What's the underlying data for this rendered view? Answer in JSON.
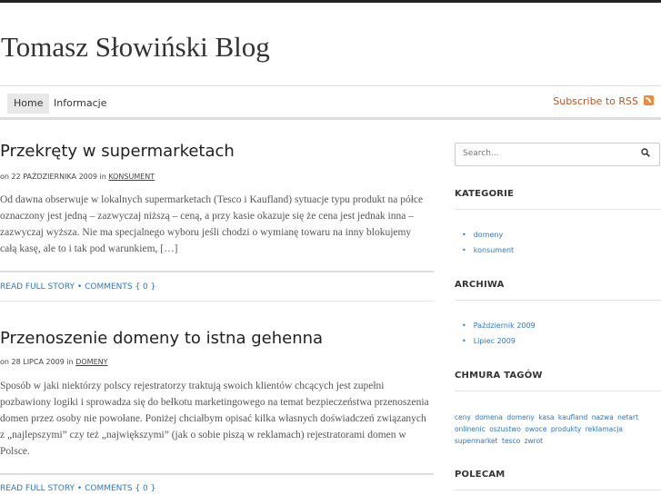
{
  "site": {
    "title": "Tomasz Słowiński Blog"
  },
  "nav": {
    "items": [
      {
        "label": "Home",
        "active": true
      },
      {
        "label": "Informacje",
        "active": false
      }
    ],
    "rss_label": "Subscribe to RSS"
  },
  "posts": [
    {
      "title": "Przekręty w supermarketach",
      "meta_prefix": "on 22 PAŹDZIERNIKA 2009 in",
      "category": "KONSUMENT",
      "body": "Od dawna obserwuje w lokalnych supermarketach (Tesco i Kaufland) sytuacje typu produkt na półce oznaczony jest jedną – zazwyczaj niższą – ceną, a przy kasie okazuje się że cena jest jednak inna – zazwyczaj wyższa. Nie ma specjalnego wyboru jeśli chodzi o wymianę towaru na inny blokujemy całą kasę, ale to i tak pod warunkiem, […]",
      "read_more": "READ FULL STORY",
      "comments": "COMMENTS { 0 }"
    },
    {
      "title": "Przenoszenie domeny to istna gehenna",
      "meta_prefix": "on 28 LIPCA 2009 in",
      "category": "DOMENY",
      "body": "Sposób w jaki niektórzy polscy rejestratorzy traktują swoich klientów chcących jest zupełni pozbawiony logiki i sprowadza się do bełkotu marketingowego na temat bezpieczeństwa przenoszenia domen przez osoby nie powołane. Poniżej chciałbym opisać kilka własnych doświadczeń związanych z „najlepszymi” czy też „największymi” (jak o sobie piszą w reklamach) rejestratorami domen w Polsce.",
      "read_more": "READ FULL STORY",
      "comments": "COMMENTS { 0 }"
    }
  ],
  "sidebar": {
    "search_placeholder": "Search...",
    "categories_title": "KATEGORIE",
    "categories": [
      "domeny",
      "konsument"
    ],
    "archives_title": "ARCHIWA",
    "archives": [
      "Październik 2009",
      "Lipiec 2009"
    ],
    "tags_title": "CHMURA TAGÓW",
    "tags": [
      "ceny",
      "domena",
      "domeny",
      "kasa",
      "kaufland",
      "nazwa",
      "netart",
      "onlinenic",
      "oszustwo",
      "owoce",
      "produkty",
      "reklamacja",
      "supermarket",
      "tesco",
      "zwrot"
    ],
    "polecam_title": "POLECAM"
  },
  "colors": {
    "link": "#2a78c8",
    "rss": "#c0541a",
    "rss_icon": "#f0893a"
  },
  "icons": {
    "rss": "rss-icon",
    "search": "search-icon"
  }
}
